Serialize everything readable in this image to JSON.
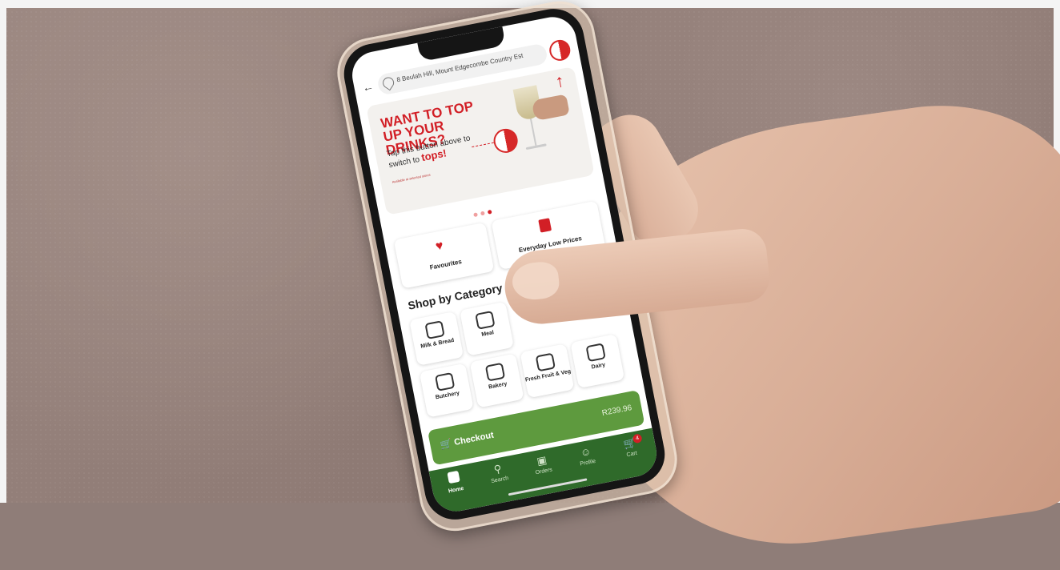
{
  "address": {
    "text": "8 Beulah Hill, Mount Edgecombe Country Est"
  },
  "banner": {
    "headline": "WANT TO TOP UP YOUR DRINKS?",
    "subtext_prefix": "Tap this button above to switch to ",
    "brand": "tops!",
    "fine_print": "Available at selected stores"
  },
  "quick_links": [
    {
      "label": "Favourites",
      "icon": "heart-icon"
    },
    {
      "label": "Everyday Low Prices",
      "icon": "shopping-bag-icon"
    }
  ],
  "categories_title": "Shop by Category",
  "categories": [
    {
      "label": "Milk & Bread",
      "icon": "milk-bread-icon"
    },
    {
      "label": "Meal",
      "icon": "meal-pie-icon"
    },
    {
      "label": "Butchery",
      "icon": "meat-icon"
    },
    {
      "label": "Bakery",
      "icon": "cake-icon"
    },
    {
      "label": "Fresh Fruit & Veg",
      "icon": "fruit-veg-icon"
    },
    {
      "label": "Dairy",
      "icon": "dairy-icon"
    }
  ],
  "checkout": {
    "label": "Checkout",
    "total": "R239.96"
  },
  "nav": [
    {
      "label": "Home",
      "icon": "home-logo-icon",
      "active": true
    },
    {
      "label": "Search",
      "icon": "search-icon",
      "active": false
    },
    {
      "label": "Orders",
      "icon": "orders-icon",
      "active": false
    },
    {
      "label": "Profile",
      "icon": "profile-icon",
      "active": false
    },
    {
      "label": "Cart",
      "icon": "cart-icon",
      "active": false,
      "badge": "4"
    }
  ],
  "colors": {
    "brand_red": "#d21f26",
    "checkout_green": "#5e9a3e",
    "nav_green": "#2f6a2a"
  }
}
